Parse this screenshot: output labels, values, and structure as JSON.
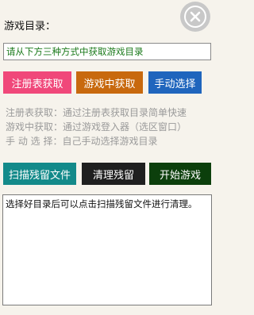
{
  "header": {
    "title": "游戏目录：",
    "close_icon": "close-circle-icon"
  },
  "path_field": {
    "placeholder": "请从下方三种方式中获取游戏目录"
  },
  "methods": {
    "registry_label": "注册表获取",
    "ingame_label": "游戏中获取",
    "manual_label": "手动选择"
  },
  "info": {
    "line1": "注册表获取：通过注册表获取目录简单快速",
    "line2": "游戏中获取：通过游戏登入器（选区窗口）",
    "line3": "手 动 选 择：自己手动选择游戏目录"
  },
  "actions": {
    "scan_label": "扫描残留文件",
    "clean_label": "清理残留",
    "start_label": "开始游戏"
  },
  "log": {
    "text": "选择好目录后可以点击扫描残留文件进行清理。"
  },
  "colors": {
    "registry_btn": "#f0487a",
    "ingame_btn": "#c8690e",
    "manual_btn": "#1f65bd",
    "scan_btn": "#138a8a",
    "clean_btn": "#1f1f1f",
    "start_btn": "#0c3f0c",
    "path_text": "#1b7a1b"
  }
}
